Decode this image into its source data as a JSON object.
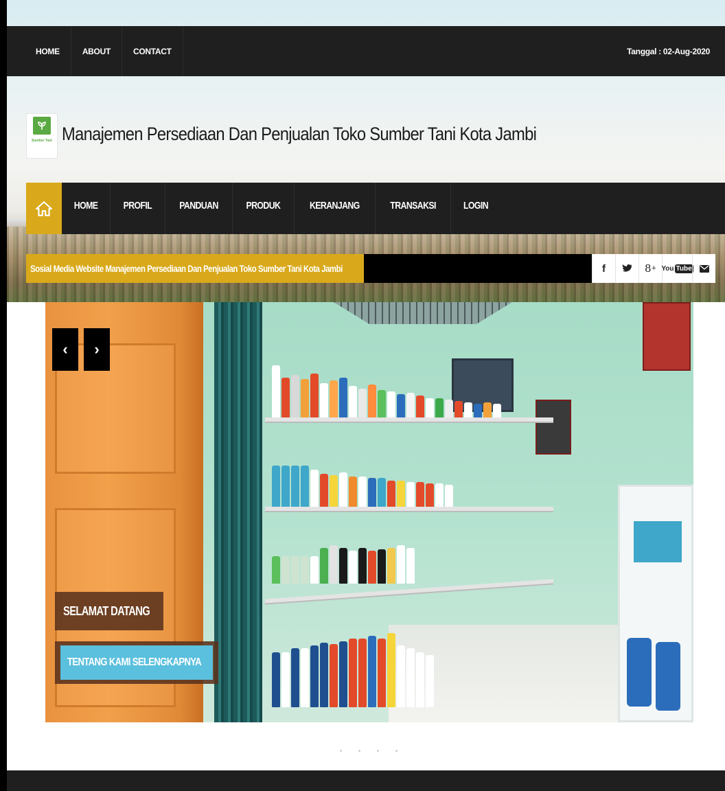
{
  "topbar": {
    "links": [
      "HOME",
      "ABOUT",
      "CONTACT"
    ],
    "date": "Tanggal : 02-Aug-2020"
  },
  "logo": {
    "text": "Sumber Tani"
  },
  "site_title": "Manajemen Persediaan Dan Penjualan Toko Sumber Tani Kota Jambi",
  "main_nav": [
    "HOME",
    "PROFIL",
    "PANDUAN",
    "PRODUK",
    "KERANJANG",
    "TRANSAKSI",
    "LOGIN"
  ],
  "social_bar": {
    "text": "Sosial Media Website Manajemen Persediaan Dan Penjualan Toko Sumber Tani Kota Jambi",
    "icons": [
      "facebook-icon",
      "twitter-icon",
      "google-plus-icon",
      "youtube-icon",
      "mail-icon"
    ]
  },
  "slider": {
    "prev": "‹",
    "next": "›",
    "caption_title": "SELAMAT DATANG",
    "caption_button": "TENTANG KAMI SELENGKAPNYA",
    "dot_count": 4
  },
  "colors": {
    "accent": "#d9a91b",
    "dark": "#1f1f1f",
    "button": "#5bc0de",
    "caption_bg": "#5a321e"
  }
}
